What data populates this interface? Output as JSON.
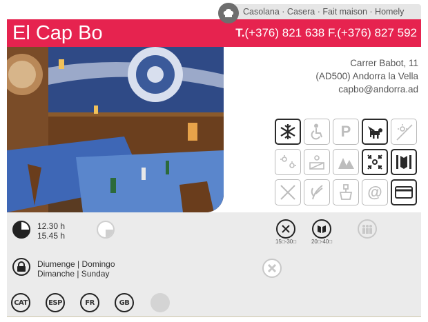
{
  "cuisine": "Casolana · Casera · Fait maison · Homely",
  "restaurant_name": "El Cap Bo",
  "phones": {
    "t_prefix": "T.",
    "t_number": "(+376) 821 638",
    "f_prefix": "F.",
    "f_number": "(+376) 827 592"
  },
  "address": {
    "street": "Carrer Babot, 11",
    "city": "(AD500) Andorra la Vella",
    "email": "capbo@andorra.ad"
  },
  "services_grid": [
    {
      "icon": "air-conditioning-icon",
      "active": true
    },
    {
      "icon": "wheelchair-access-icon",
      "active": false
    },
    {
      "icon": "parking-icon",
      "text": "P",
      "active": false
    },
    {
      "icon": "pets-allowed-icon",
      "active": true
    },
    {
      "icon": "terrace-icon",
      "active": false
    },
    {
      "icon": "summer-icon",
      "active": false
    },
    {
      "icon": "view-icon",
      "active": false
    },
    {
      "icon": "mountain-icon",
      "active": false
    },
    {
      "icon": "central-location-icon",
      "active": true
    },
    {
      "icon": "menu-icon",
      "active": true
    },
    {
      "icon": "no-service-icon",
      "active": false
    },
    {
      "icon": "gluten-free-icon",
      "active": false
    },
    {
      "icon": "takeaway-icon",
      "active": false
    },
    {
      "icon": "email-icon",
      "text": "@",
      "active": false
    },
    {
      "icon": "credit-card-icon",
      "active": true
    }
  ],
  "schedule": {
    "lunch": "12.30 h",
    "dinner": "15.45 h"
  },
  "prices": {
    "menu_price": "15□-30□",
    "carte_price": "20□-40□"
  },
  "closed_days": {
    "line1": "Diumenge | Domingo",
    "line2": "Dimanche | Sunday"
  },
  "languages": [
    "CAT",
    "ESP",
    "FR",
    "GB"
  ]
}
